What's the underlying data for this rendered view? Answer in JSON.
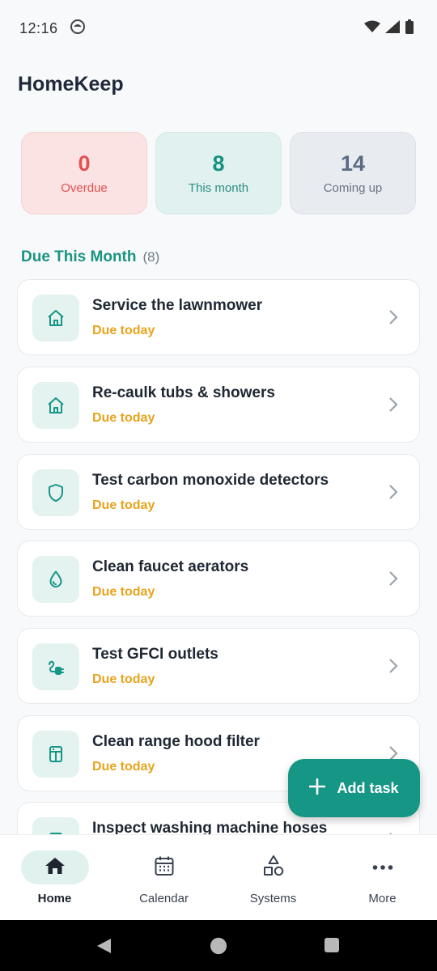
{
  "status": {
    "time": "12:16"
  },
  "app": {
    "title": "HomeKeep"
  },
  "stats": [
    {
      "value": "0",
      "label": "Overdue"
    },
    {
      "value": "8",
      "label": "This month"
    },
    {
      "value": "14",
      "label": "Coming up"
    }
  ],
  "section": {
    "title": "Due This Month",
    "count": "(8)"
  },
  "tasks": [
    {
      "title": "Service the lawnmower",
      "due": "Due today",
      "icon": "home-icon"
    },
    {
      "title": "Re-caulk tubs & showers",
      "due": "Due today",
      "icon": "home-icon"
    },
    {
      "title": "Test carbon monoxide detectors",
      "due": "Due today",
      "icon": "shield-icon"
    },
    {
      "title": "Clean faucet aerators",
      "due": "Due today",
      "icon": "water-drop-icon"
    },
    {
      "title": "Test GFCI outlets",
      "due": "Due today",
      "icon": "plug-icon"
    },
    {
      "title": "Clean range hood filter",
      "due": "Due today",
      "icon": "appliance-icon"
    },
    {
      "title": "Inspect washing machine hoses",
      "due": "",
      "icon": "appliance-icon"
    }
  ],
  "fab": {
    "label": "Add task"
  },
  "nav": [
    {
      "label": "Home",
      "icon": "home-filled-icon"
    },
    {
      "label": "Calendar",
      "icon": "calendar-icon"
    },
    {
      "label": "Systems",
      "icon": "shapes-icon"
    },
    {
      "label": "More",
      "icon": "more-dots-icon"
    }
  ],
  "colors": {
    "accent": "#169685",
    "overdue": "#e45050",
    "due": "#e8a31c"
  }
}
